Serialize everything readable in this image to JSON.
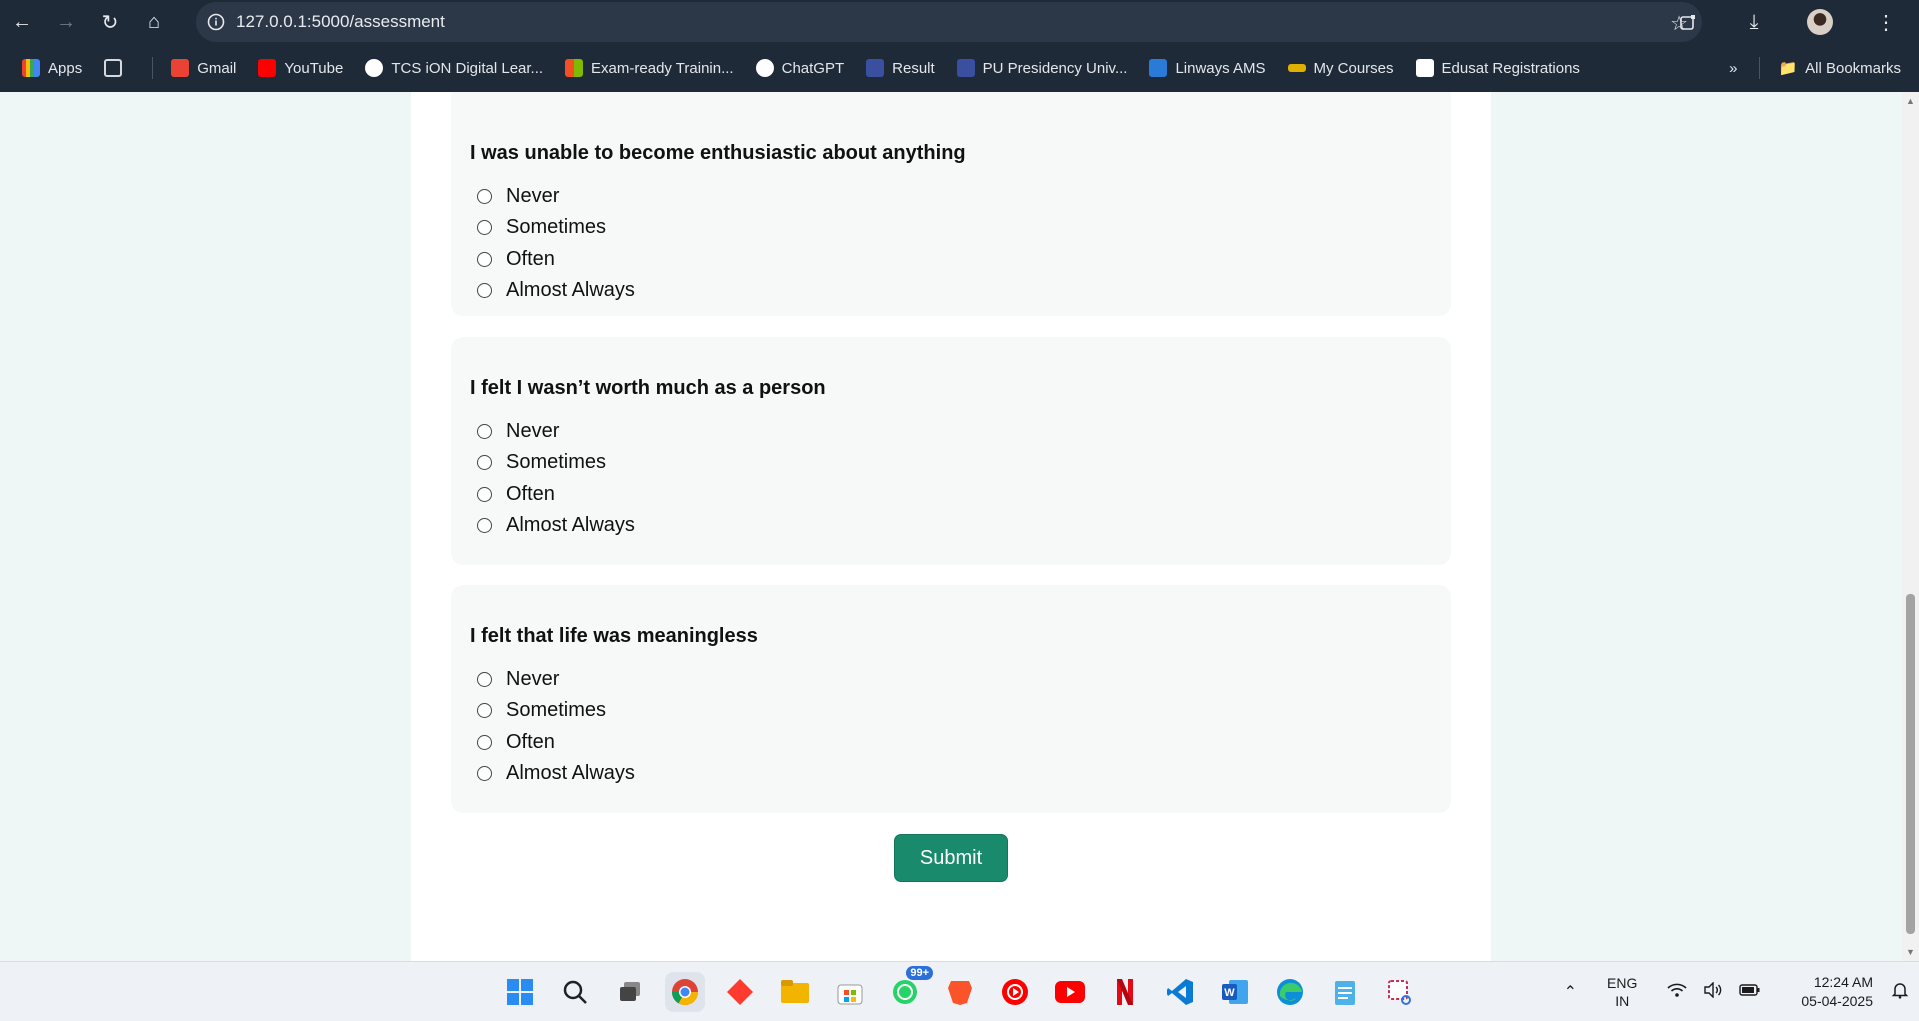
{
  "browser": {
    "url": "127.0.0.1:5000/assessment"
  },
  "bookmarks": {
    "items": [
      {
        "label": "Apps",
        "icon": "apps-grid-icon",
        "color": "#f4b400"
      },
      {
        "label": "",
        "icon": "tab-groups-icon",
        "color": "#d5d9df"
      },
      {
        "label": "Gmail",
        "icon": "gmail-icon",
        "color": "#ea4335"
      },
      {
        "label": "YouTube",
        "icon": "youtube-icon",
        "color": "#ff0000"
      },
      {
        "label": "TCS iON Digital Lear...",
        "icon": "tcs-ion-icon",
        "color": "#ffffff"
      },
      {
        "label": "Exam-ready Trainin...",
        "icon": "microsoft-icon",
        "color": "#7fba00"
      },
      {
        "label": "ChatGPT",
        "icon": "chatgpt-icon",
        "color": "#ffffff"
      },
      {
        "label": "Result",
        "icon": "result-icon",
        "color": "#3b4fa0"
      },
      {
        "label": "PU Presidency Univ...",
        "icon": "pu-icon",
        "color": "#3b4fa0"
      },
      {
        "label": "Linways AMS",
        "icon": "linways-icon",
        "color": "#2a7bd8"
      },
      {
        "label": "My Courses",
        "icon": "courses-icon",
        "color": "#e0b000"
      },
      {
        "label": "Edusat Registrations",
        "icon": "edusat-icon",
        "color": "#ffffff"
      }
    ],
    "all_bookmarks": "All Bookmarks"
  },
  "questions": [
    {
      "text": "I was unable to become enthusiastic about anything",
      "options": [
        "Never",
        "Sometimes",
        "Often",
        "Almost Always"
      ]
    },
    {
      "text": "I felt I wasn’t worth much as a person",
      "options": [
        "Never",
        "Sometimes",
        "Often",
        "Almost Always"
      ]
    },
    {
      "text": "I felt that life was meaningless",
      "options": [
        "Never",
        "Sometimes",
        "Often",
        "Almost Always"
      ]
    }
  ],
  "submit_label": "Submit",
  "taskbar": {
    "whatsapp_badge": "99+",
    "lang_line1": "ENG",
    "lang_line2": "IN",
    "time": "12:24 AM",
    "date": "05-04-2025"
  },
  "colors": {
    "accent": "#1a8a6c",
    "page_bg": "#eef7f5"
  }
}
